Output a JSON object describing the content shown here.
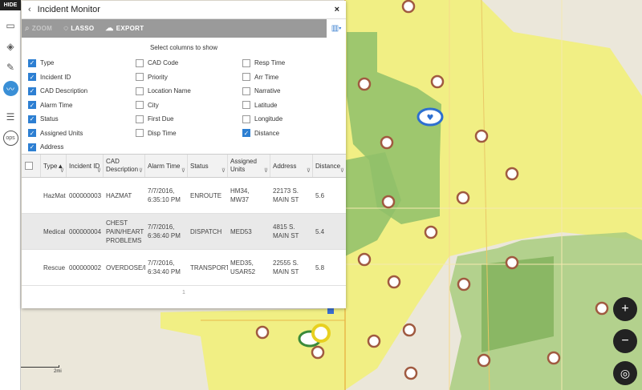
{
  "rail": {
    "hide_label": "HIDE",
    "ops_label": "ops"
  },
  "panel": {
    "title": "Incident Monitor",
    "toolbar": {
      "zoom": "ZOOM",
      "lasso": "LASSO",
      "export": "EXPORT"
    },
    "columns_title": "Select columns to show",
    "columns": [
      [
        {
          "label": "Type",
          "checked": true
        },
        {
          "label": "Incident ID",
          "checked": true
        },
        {
          "label": "CAD Description",
          "checked": true
        },
        {
          "label": "Alarm Time",
          "checked": true
        },
        {
          "label": "Status",
          "checked": true
        },
        {
          "label": "Assigned Units",
          "checked": true
        },
        {
          "label": "Address",
          "checked": true
        }
      ],
      [
        {
          "label": "CAD Code",
          "checked": false
        },
        {
          "label": "Priority",
          "checked": false
        },
        {
          "label": "Location Name",
          "checked": false
        },
        {
          "label": "City",
          "checked": false
        },
        {
          "label": "First Due",
          "checked": false
        },
        {
          "label": "Disp Time",
          "checked": false
        }
      ],
      [
        {
          "label": "Resp Time",
          "checked": false
        },
        {
          "label": "Arr Time",
          "checked": false
        },
        {
          "label": "Narrative",
          "checked": false
        },
        {
          "label": "Latitude",
          "checked": false
        },
        {
          "label": "Longitude",
          "checked": false
        },
        {
          "label": "Distance",
          "checked": true
        }
      ]
    ],
    "table": {
      "headers": {
        "type": "Type",
        "type_sort": "▲",
        "incident_id": "Incident ID",
        "cad_desc": "CAD Description",
        "alarm_time": "Alarm Time",
        "status": "Status",
        "units": "Assigned Units",
        "address": "Address",
        "distance": "Distance"
      },
      "rows": [
        {
          "type": "HazMat",
          "id": "000000003",
          "desc": "HAZMAT",
          "time": "7/7/2016, 6:35:10 PM",
          "status": "ENROUTE",
          "units": "HM34, MW37",
          "address": "22173 S. MAIN ST",
          "distance": "5.6"
        },
        {
          "type": "Medical",
          "id": "000000004",
          "desc": "CHEST PAIN/HEART PROBLEMS",
          "time": "7/7/2016, 6:36:40 PM",
          "status": "DISPATCH",
          "units": "MED53",
          "address": "4815 S. MAIN ST",
          "distance": "5.4"
        },
        {
          "type": "Rescue",
          "id": "000000002",
          "desc": "OVERDOSE/PO",
          "time": "7/7/2016, 6:34:40 PM",
          "status": "TRANSPORT",
          "units": "MED35, USAR52",
          "address": "22555 S. MAIN ST",
          "distance": "5.8"
        }
      ],
      "page": "1"
    }
  },
  "map": {
    "scale_start": "0",
    "scale_end": "2mi",
    "zoom_in": "+",
    "zoom_out": "−",
    "locate": "◎"
  },
  "colors": {
    "accent": "#2d7fd2",
    "toolbar": "#9a9a9a",
    "map_yellow": "#f2f07a",
    "map_green": "#8fbf6a"
  }
}
